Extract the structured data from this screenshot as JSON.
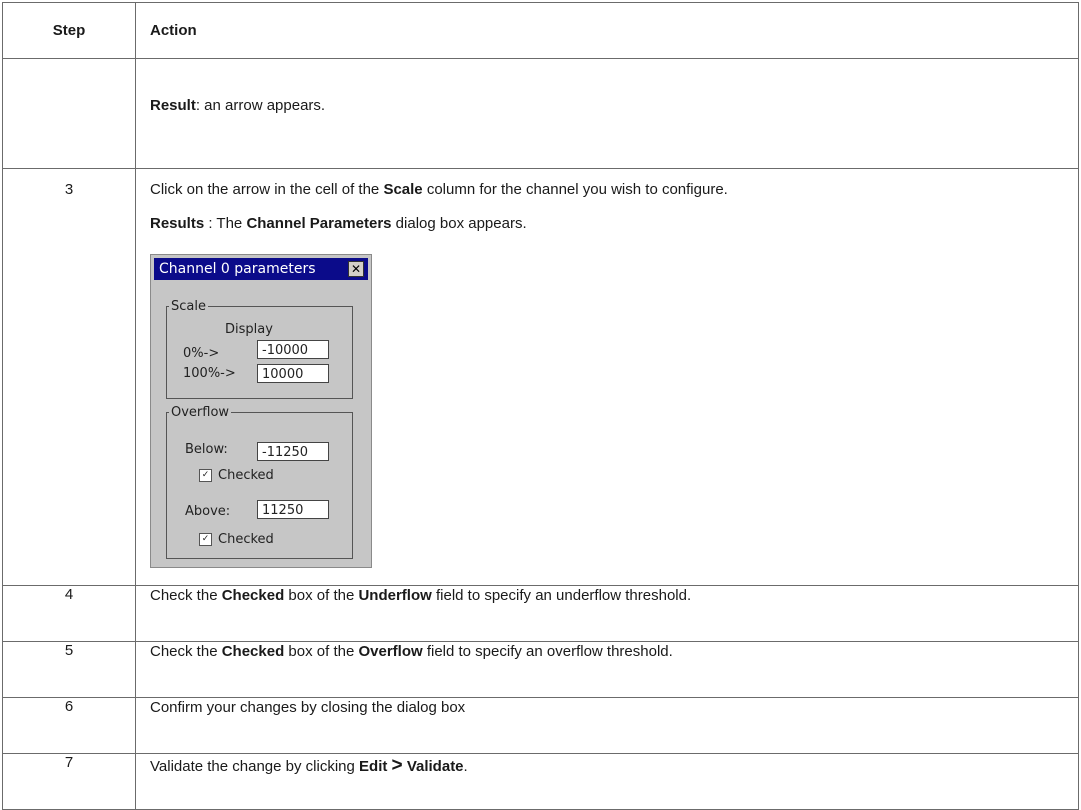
{
  "table": {
    "header": {
      "step": "Step",
      "action": "Action"
    },
    "rows": [
      {
        "step": "",
        "bold": "Result",
        "text": ": an arrow appears."
      },
      {
        "step": "3",
        "line1": {
          "pre": "Click on the arrow in the cell of the ",
          "bold": "Scale",
          "post": " column for the channel you wish to configure."
        },
        "line2": {
          "bold1": "Results",
          "mid": " : The ",
          "bold2": "Channel Parameters",
          "post": " dialog box appears."
        }
      },
      {
        "step": "4",
        "pre": "Check the ",
        "b1": "Checked",
        "mid": " box of the ",
        "b2": "Underflow",
        "post": " field to specify an underflow threshold."
      },
      {
        "step": "5",
        "pre": "Check the ",
        "b1": "Checked",
        "mid": " box of the ",
        "b2": "Overflow",
        "post": " field to specify an overflow threshold."
      },
      {
        "step": "6",
        "text": "Confirm your changes by closing the dialog box"
      },
      {
        "step": "7",
        "pre": "Validate the change by clicking ",
        "b1": "Edit",
        "sep": ">",
        "b2": "Validate",
        "post": "."
      }
    ]
  },
  "dialog": {
    "title": "Channel 0 parameters",
    "close_glyph": "✕",
    "scale": {
      "legend": "Scale",
      "display_label": "Display",
      "min_label": "0%->",
      "min_value": "-10000",
      "max_label": "100%->",
      "max_value": "10000"
    },
    "overflow": {
      "legend": "Overflow",
      "below_label": "Below:",
      "below_value": "-11250",
      "below_checked_label": "Checked",
      "above_label": "Above:",
      "above_value": "11250",
      "above_checked_label": "Checked",
      "check_glyph": "✓"
    }
  }
}
